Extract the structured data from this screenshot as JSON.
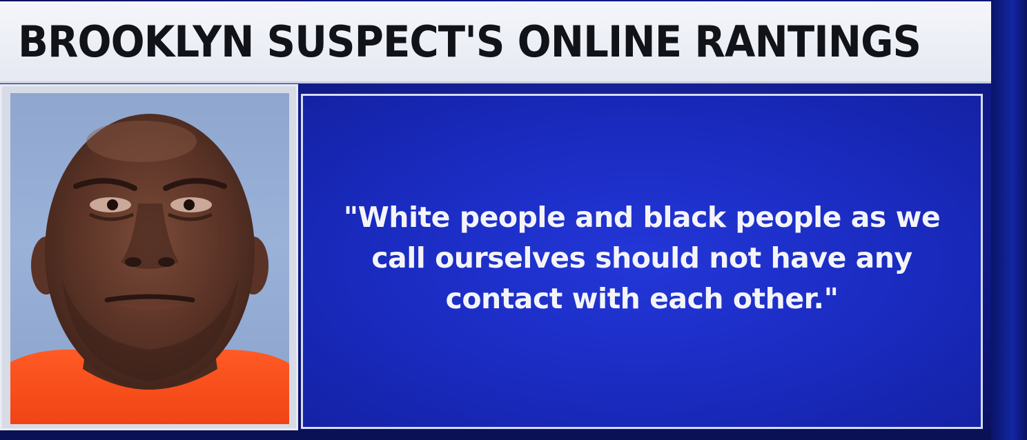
{
  "headline": "BROOKLYN SUSPECT'S ONLINE RANTINGS",
  "quote": "\"White people and black people as we call ourselves should not have any contact with each other.\"",
  "colors": {
    "headline_bar": "#eef0f6",
    "headline_text": "#111318",
    "panel_blue": "#1a2bc0",
    "quote_text": "#f4f4f8",
    "photo_background": "#9ab1d8",
    "shirt_orange": "#ff4e1c"
  }
}
